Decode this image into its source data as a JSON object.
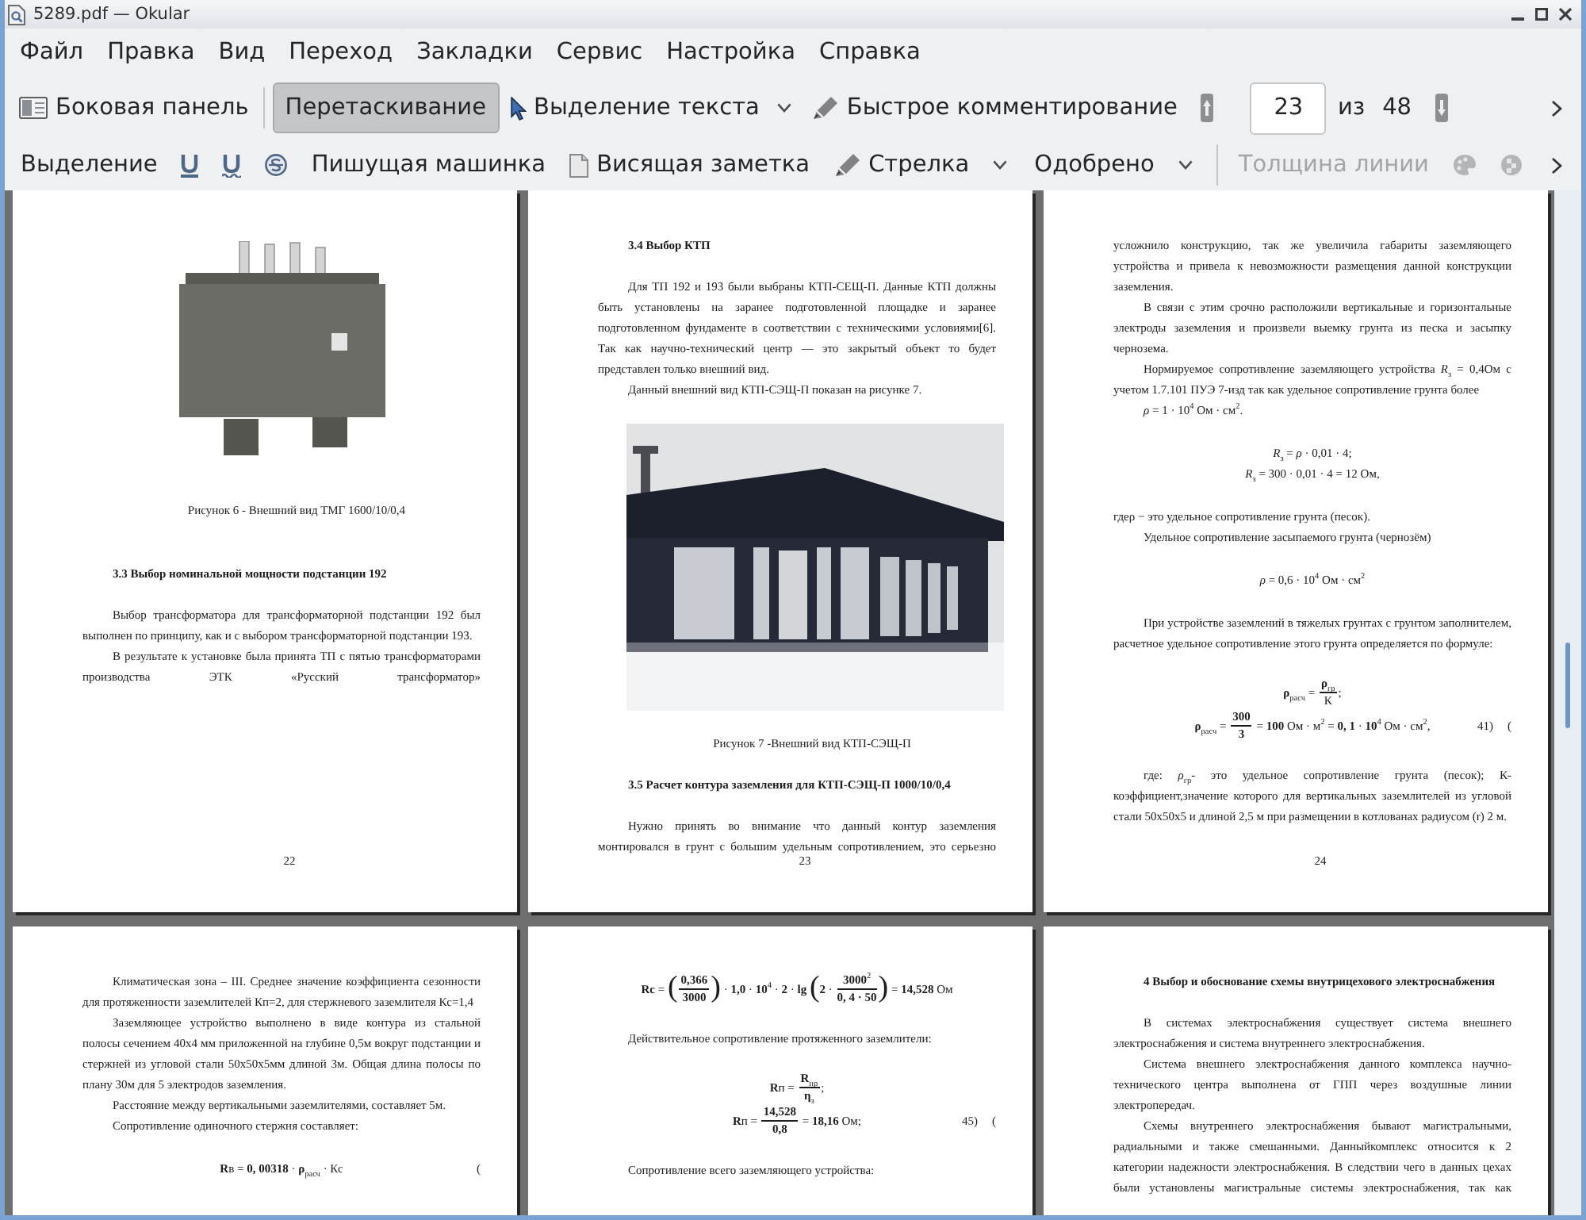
{
  "window": {
    "title": "5289.pdf — Okular"
  },
  "menu": [
    "Файл",
    "Правка",
    "Вид",
    "Переход",
    "Закладки",
    "Сервис",
    "Настройка",
    "Справка"
  ],
  "main_toolbar": {
    "sidebar_button": {
      "label": "Боковая панель"
    },
    "modes": [
      {
        "kind": "browse",
        "label": "Перетаскивание",
        "selected": true
      },
      {
        "kind": "textselect",
        "label": "Выделение текста",
        "selected": false
      }
    ],
    "quick_annotations_button": {
      "label": "Быстрое комментирование"
    },
    "page_navigation": {
      "page": "23",
      "of": "из",
      "total": "48"
    }
  },
  "annotation_toolbar": {
    "tools": [
      {
        "kind": "highlight",
        "label": "Выделение",
        "disabled": false
      },
      {
        "kind": "underline",
        "disabled": false
      },
      {
        "kind": "squiggle",
        "disabled": false
      },
      {
        "kind": "strikeout",
        "disabled": false
      },
      {
        "kind": "typewriter",
        "label": "Пишущая машинка",
        "disabled": false
      },
      {
        "kind": "note",
        "label": "Висящая заметка",
        "disabled": false
      },
      {
        "kind": "arrow",
        "label": "Стрелка",
        "disabled": false
      },
      {
        "kind": "stamp",
        "label": "Одобрено",
        "disabled": false
      }
    ],
    "settings": [
      {
        "kind": "linewidth",
        "label": "Толщина линии",
        "disabled": true
      },
      {
        "kind": "color",
        "disabled": true
      },
      {
        "kind": "opacity",
        "disabled": true
      }
    ]
  },
  "pages": [
    {
      "number": "22",
      "blocks": [
        {
          "kind": "tallphoto"
        },
        {
          "kind": "caption",
          "text": "Рисунок 6 - Внешний вид ТМГ 1600/10/0,4"
        },
        {
          "kind": "heading",
          "text": "3.3 Выбор номинальной мощности подстанции 192"
        },
        {
          "kind": "paragraph",
          "indent": true,
          "text": "Выбор трансформатора для трансформаторной подстанции 192 был выполнен по принципу, как и с выбором трансформаторной подстанции 193."
        },
        {
          "kind": "runon",
          "indent": true,
          "text": "В результате к установке была принята ТП с пятью трансформаторами производства ЭТК «Русский трансформатор»"
        }
      ]
    },
    {
      "number": "23",
      "blocks": [
        {
          "kind": "heading",
          "text": "3.4 Выбор КТП"
        },
        {
          "kind": "paragraph",
          "indent": true,
          "text": "Для ТП 192 и 193 были выбраны КТП-СЕЩ-П. Данные КТП должны быть установлены на заранее подготовленной площадке и заранее подготовленном фундаменте в соответствии с техническими условиями[6]. Так как научно-технический центр — это закрытый объект то будет представлен только внешний вид."
        },
        {
          "kind": "paragraph",
          "indent": true,
          "text": "Данный внешний вид КТП-СЭЩ-П показан на рисунке 7."
        },
        {
          "kind": "widephoto"
        },
        {
          "kind": "caption",
          "text": "Рисунок 7 -Внешний вид КТП-СЭЩ-П"
        },
        {
          "kind": "heading",
          "text": "3.5 Расчет контура заземления для КТП-СЭЩ-П 1000/10/0,4"
        },
        {
          "kind": "runon",
          "indent": true,
          "text": "Нужно принять во внимание что данный контур заземления монтировался в грунт с большим удельным сопротивлением, это серьезно"
        }
      ]
    },
    {
      "number": "24",
      "blocks": [
        {
          "kind": "paragraph",
          "indent": false,
          "text": "усложнило конструкцию, так же увеличила габариты заземляющего устройства и привела к невозможности размещения данной конструкции заземления."
        },
        {
          "kind": "paragraph",
          "indent": true,
          "text": "В связи с этим срочно расположили вертикальные и горизонтальные электроды заземления и произвели выемку грунта из песка и засыпку чернозема."
        },
        {
          "kind": "paragraph",
          "indent": true,
          "text": "Нормируемое сопротивление заземляющего устройства *R*$_{з}$ = 0,4Ом с учетом 1.7.101 ПУЭ 7-изд так как удельное сопротивление грунта более"
        },
        {
          "kind": "paragraph",
          "indent": true,
          "text": "*ρ* = 1 · 10$^{4}$ Ом · см$^{2}$."
        },
        {
          "kind": "formula",
          "parts": [
            {
              "kind": "text",
              "text": "*R*$_{з}$ = *ρ* · 0,01 · 4;"
            }
          ]
        },
        {
          "kind": "formula",
          "parts": [
            {
              "kind": "text",
              "text": "*R*$_{з}$ = 300 · 0,01 · 4 = 12 Ом,"
            }
          ]
        },
        {
          "kind": "paragraph",
          "indent": false,
          "text": "гдеρ − это удельное сопротивление грунта (песок)."
        },
        {
          "kind": "paragraph",
          "indent": true,
          "text": "Удельное сопротивление засыпаемого грунта (чернозём)"
        },
        {
          "kind": "formula",
          "parts": [
            {
              "kind": "text",
              "text": "*ρ* = 0,6 · 10$^{4}$ Ом · см$^{2}$"
            }
          ]
        },
        {
          "kind": "paragraph",
          "indent": true,
          "text": "При устройстве заземлений в тяжелых грунтах с грунтом заполнителем, расчетное удельное сопротивление этого грунта определяется по формуле:"
        },
        {
          "kind": "formula",
          "parts": [
            {
              "kind": "text",
              "text": "**ρ**$_{расч}$ = "
            },
            {
              "kind": "frac",
              "num": "**ρ**$_{гр}$",
              "den": "К"
            },
            {
              "kind": "text",
              "text": ";"
            }
          ]
        },
        {
          "kind": "formula",
          "parts": [
            {
              "kind": "text",
              "text": "**ρ**$_{расч}$ = "
            },
            {
              "kind": "frac",
              "num": "**300**",
              "den": "**3**"
            },
            {
              "kind": "text",
              "text": " = **100** Ом · м$^{2}$ = **0, 1** · **10**$^{4}$ Ом · см$^{2}$,"
            }
          ],
          "tag": {
            "number": "41)",
            "open": "("
          }
        },
        {
          "kind": "paragraph",
          "indent": true,
          "text": "где: *ρ*$_{гр}$- это удельное сопротивление грунта (песок); К-коэффициент,значение которого для вертикальных заземлителей из угловой стали 50х50х5 и длиной 2,5 м при размещении в котлованах радиусом (r) 2 м."
        }
      ]
    },
    {
      "blocks": [
        {
          "kind": "paragraph",
          "indent": true,
          "text": "Климатическая зона – III. Среднее значение коэффициента сезонности для протяженности заземлителей Кп=2, для стержневого заземлителя Кс=1,4"
        },
        {
          "kind": "paragraph",
          "indent": true,
          "text": "Заземляющее устройство выполнено в виде контура из стальной полосы сечением 40х4 мм приложенной на глубине 0,5м вокруг подстанции и стержней из угловой стали 50х50х5мм длиной 3м. Общая длина полосы по плану 30м для 5 электродов заземления."
        },
        {
          "kind": "paragraph",
          "indent": true,
          "text": "Расстояние между вертикальными заземлителями, составляет 5м."
        },
        {
          "kind": "paragraph",
          "indent": true,
          "text": "Сопротивление одиночного стержня составляет:"
        },
        {
          "kind": "formula",
          "parts": [
            {
              "kind": "text",
              "text": "**R**в = **0, 00318** · **ρ**$_{расч}$ · Кс"
            }
          ],
          "tag": {
            "open": "("
          }
        }
      ]
    },
    {
      "blocks": [
        {
          "kind": "formula",
          "parts": [
            {
              "kind": "text",
              "text": "**Rc** = "
            },
            {
              "kind": "paren",
              "text": "("
            },
            {
              "kind": "frac",
              "num": "**0,366**",
              "den": "**3000**"
            },
            {
              "kind": "paren",
              "text": ")"
            },
            {
              "kind": "text",
              "text": " · **1,0** · **10**$^{4}$ · **2** · **lg** "
            },
            {
              "kind": "paren",
              "text": "("
            },
            {
              "kind": "text",
              "text": "**2** · "
            },
            {
              "kind": "frac",
              "num": "**3000**$^{2}$",
              "den": "**0, 4 · 50**"
            },
            {
              "kind": "paren",
              "text": ")"
            },
            {
              "kind": "text",
              "text": " = **14,528** Ом"
            }
          ]
        },
        {
          "kind": "paragraph",
          "indent": true,
          "text": "Действительное сопротивление протяженного заземлители:"
        },
        {
          "kind": "formula",
          "parts": [
            {
              "kind": "text",
              "text": "**R**п = "
            },
            {
              "kind": "frac",
              "num": "**R**$_{пр}$",
              "den": "**η**$_{з}$"
            },
            {
              "kind": "text",
              "text": ";"
            }
          ]
        },
        {
          "kind": "formula",
          "parts": [
            {
              "kind": "text",
              "text": "**R**п = "
            },
            {
              "kind": "frac",
              "num": "**14,528**",
              "den": "**0,8**"
            },
            {
              "kind": "text",
              "text": " = **18,16** Ом;"
            }
          ],
          "tag": {
            "number": "45)",
            "open": "("
          }
        },
        {
          "kind": "paragraph",
          "indent": true,
          "text": "Сопротивление всего заземляющего устройства:"
        }
      ]
    },
    {
      "blocks": [
        {
          "kind": "heading",
          "text": "4 Выбор и обоснование схемы внутрицехового электроснабжения"
        },
        {
          "kind": "paragraph",
          "indent": true,
          "text": "В системах электроснабжения существует система внешнего электроснабжения и система внутреннего электроснабжения."
        },
        {
          "kind": "paragraph",
          "indent": true,
          "text": "Система внешнего электроснабжения данного комплекса научно-технического центра выполнена от ГПП через воздушные линии электропередач."
        },
        {
          "kind": "runon",
          "indent": true,
          "text": "Схемы внутреннего электроснабжения бывают магистральными, радиальными и также смешанными. Данныйкомплекс относится к 2 категории надежности электроснабжения. В следствии чего в данных цехах были установлены магистральные системы электроснабжения, так как"
        }
      ]
    }
  ]
}
